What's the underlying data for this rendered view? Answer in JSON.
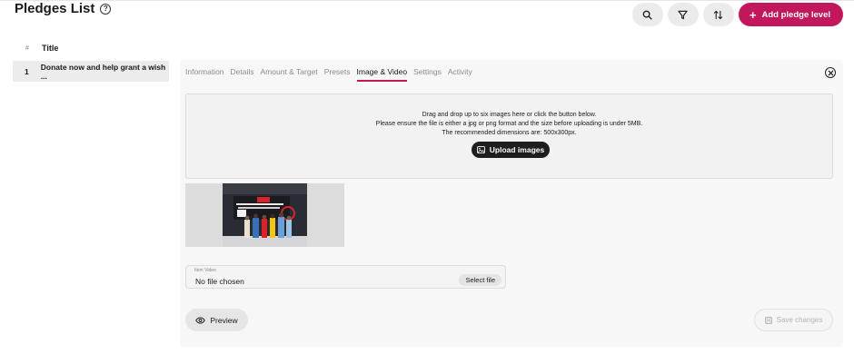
{
  "header": {
    "title": "Pledges List",
    "help_icon": "help-icon"
  },
  "toolbar": {
    "search_icon": "search-icon",
    "filter_icon": "filter-icon",
    "sort_icon": "sort-icon",
    "add_label": "Add pledge level",
    "accent": "#c2185b"
  },
  "list": {
    "columns": {
      "hash": "#",
      "title": "Title"
    },
    "rows": [
      {
        "num": "1",
        "title": "Donate now and help grant a wish ..."
      }
    ]
  },
  "detail": {
    "tabs": [
      {
        "label": "Information"
      },
      {
        "label": "Details"
      },
      {
        "label": "Amount & Target"
      },
      {
        "label": "Presets"
      },
      {
        "label": "Image & Video",
        "active": true
      },
      {
        "label": "Settings"
      },
      {
        "label": "Activity"
      }
    ],
    "dropzone": {
      "line1": "Drag and drop up to six images here or click the button below.",
      "line2": "Please ensure the file is either a jpg or png format and the size before uploading is under 5MB.",
      "line3": "The recommended dimensions are: 500x300px.",
      "upload_label": "Upload images"
    },
    "video": {
      "label": "Item Video",
      "value": "No file chosen",
      "select_label": "Select file"
    },
    "preview_label": "Preview",
    "save_label": "Save changes"
  }
}
